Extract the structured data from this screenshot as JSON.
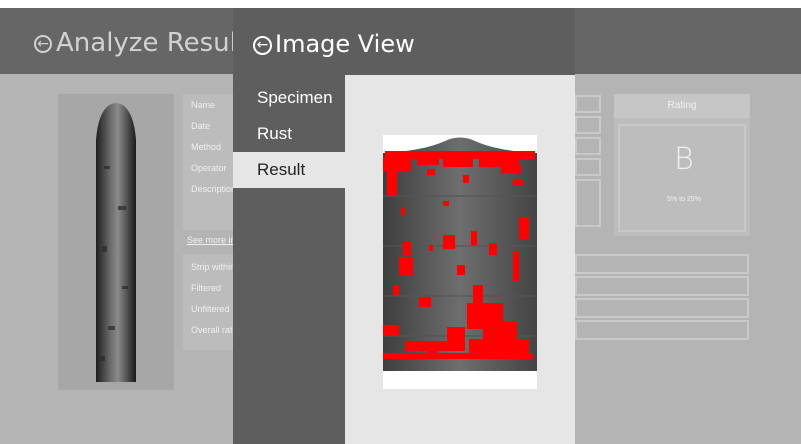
{
  "background_page": {
    "title": "Analyze Results",
    "info_fields": [
      "Name",
      "Date",
      "Method",
      "Operator",
      "Description"
    ],
    "see_more": "See more info",
    "strip_fields": [
      "Strip within",
      "Filtered",
      "Unfiltered",
      "Overall rating"
    ],
    "rating": {
      "label": "Rating",
      "grade": "B",
      "range": "5% to 25%"
    }
  },
  "image_view": {
    "title": "Image View",
    "nav_items": [
      {
        "label": "Specimen",
        "selected": false
      },
      {
        "label": "Rust",
        "selected": false
      },
      {
        "label": "Result",
        "selected": true
      }
    ],
    "highlight_color": "#ff0000"
  },
  "icons": {
    "back": "back-arrow-icon",
    "back_glyph": "←"
  }
}
